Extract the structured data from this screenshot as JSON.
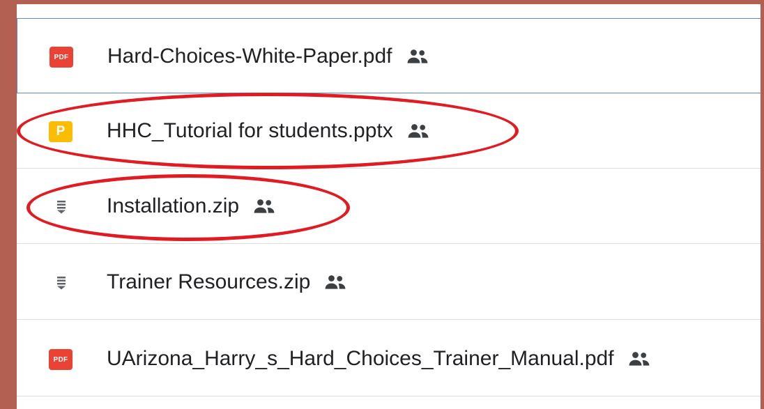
{
  "files": [
    {
      "name": "Hard-Choices-White-Paper.pdf",
      "type": "pdf",
      "icon": "pdf-icon",
      "icon_label": "PDF",
      "shared_icon": "people-icon"
    },
    {
      "name": "HHC_Tutorial for students.pptx",
      "type": "pptx",
      "icon": "slides-icon",
      "icon_label": "P",
      "shared_icon": "people-icon"
    },
    {
      "name": "Installation.zip",
      "type": "zip",
      "icon": "zip-icon",
      "shared_icon": "people-icon"
    },
    {
      "name": "Trainer Resources.zip",
      "type": "zip",
      "icon": "zip-icon",
      "shared_icon": "people-icon"
    },
    {
      "name": "UArizona_Harry_s_Hard_Choices_Trainer_Manual.pdf",
      "type": "pdf",
      "icon": "pdf-icon",
      "icon_label": "PDF",
      "shared_icon": "people-icon"
    }
  ],
  "colors": {
    "background": "#b35f51",
    "annotation": "#e11b22",
    "pdf": "#ea4335",
    "slides": "#fbbc04",
    "selection_border": "#5b87d6"
  }
}
